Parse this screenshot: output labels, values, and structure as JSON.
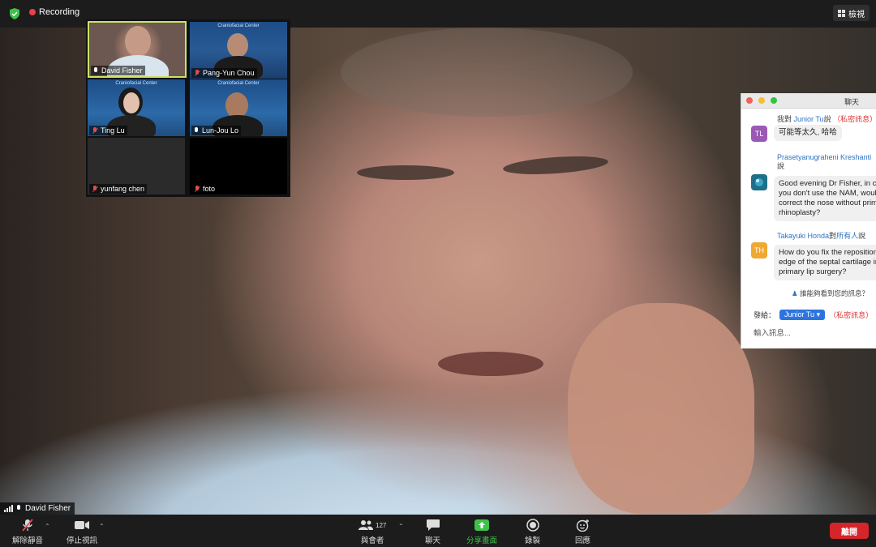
{
  "topbar": {
    "recording_label": "Recording",
    "view_label": "檢視"
  },
  "gallery": {
    "tiles": [
      {
        "name": "David Fisher",
        "muted": false,
        "active": true
      },
      {
        "name": "Pang-Yun Chou",
        "muted": true,
        "banner": "Craniofacial Center"
      },
      {
        "name": "Ting Lu",
        "muted": true,
        "banner": "Craniofacial Center"
      },
      {
        "name": "Lun-Jou Lo",
        "muted": false,
        "banner": "Craniofacial Center"
      },
      {
        "name": "yunfang chen",
        "muted": true
      },
      {
        "name": "foto",
        "muted": true
      }
    ]
  },
  "main_speaker": {
    "name": "David Fisher"
  },
  "chat": {
    "title": "聊天",
    "messages": [
      {
        "prefix": "我對",
        "recipient": "Junior Tu",
        "suffix": "說",
        "private_tag": "（私密訊息）",
        "avatar_initials": "TL",
        "avatar_color": "#9b59b6",
        "text": "可能等太久, 哈哈"
      },
      {
        "sender": "Prasetyanugraheni Kreshanti",
        "suffix": "說",
        "avatar_initials": "",
        "avatar_color": "#1f6f8b",
        "text": "Good evening Dr Fisher, in case\nyou don't use the NAM, would you\ncorrect the nose without primary\nrhinoplasty?"
      },
      {
        "sender": "Takayuki Honda",
        "middle": "對",
        "recipient": "所有人",
        "suffix": "說",
        "avatar_initials": "TH",
        "avatar_color": "#f0a830",
        "text": "How do you fix the repositioned\nedge of the septal cartilage in\nprimary lip surgery?"
      }
    ],
    "who_can_see": "誰能夠看到您的訊息？",
    "send_to_label": "發給：",
    "send_to_value": "Junior Tu",
    "send_private": "（私密訊息）",
    "input_placeholder": "輸入訊息..."
  },
  "toolbar": {
    "unmute": "解除靜音",
    "stop_video": "停止視訊",
    "participants": "與會者",
    "participants_count": "127",
    "chat": "聊天",
    "share": "分享畫面",
    "record": "錄製",
    "reactions": "回應",
    "leave": "離開"
  },
  "colors": {
    "accent_green": "#3fc14a",
    "leave_red": "#d3252a",
    "recording_red": "#e8414a",
    "active_border": "#c9e26a"
  }
}
